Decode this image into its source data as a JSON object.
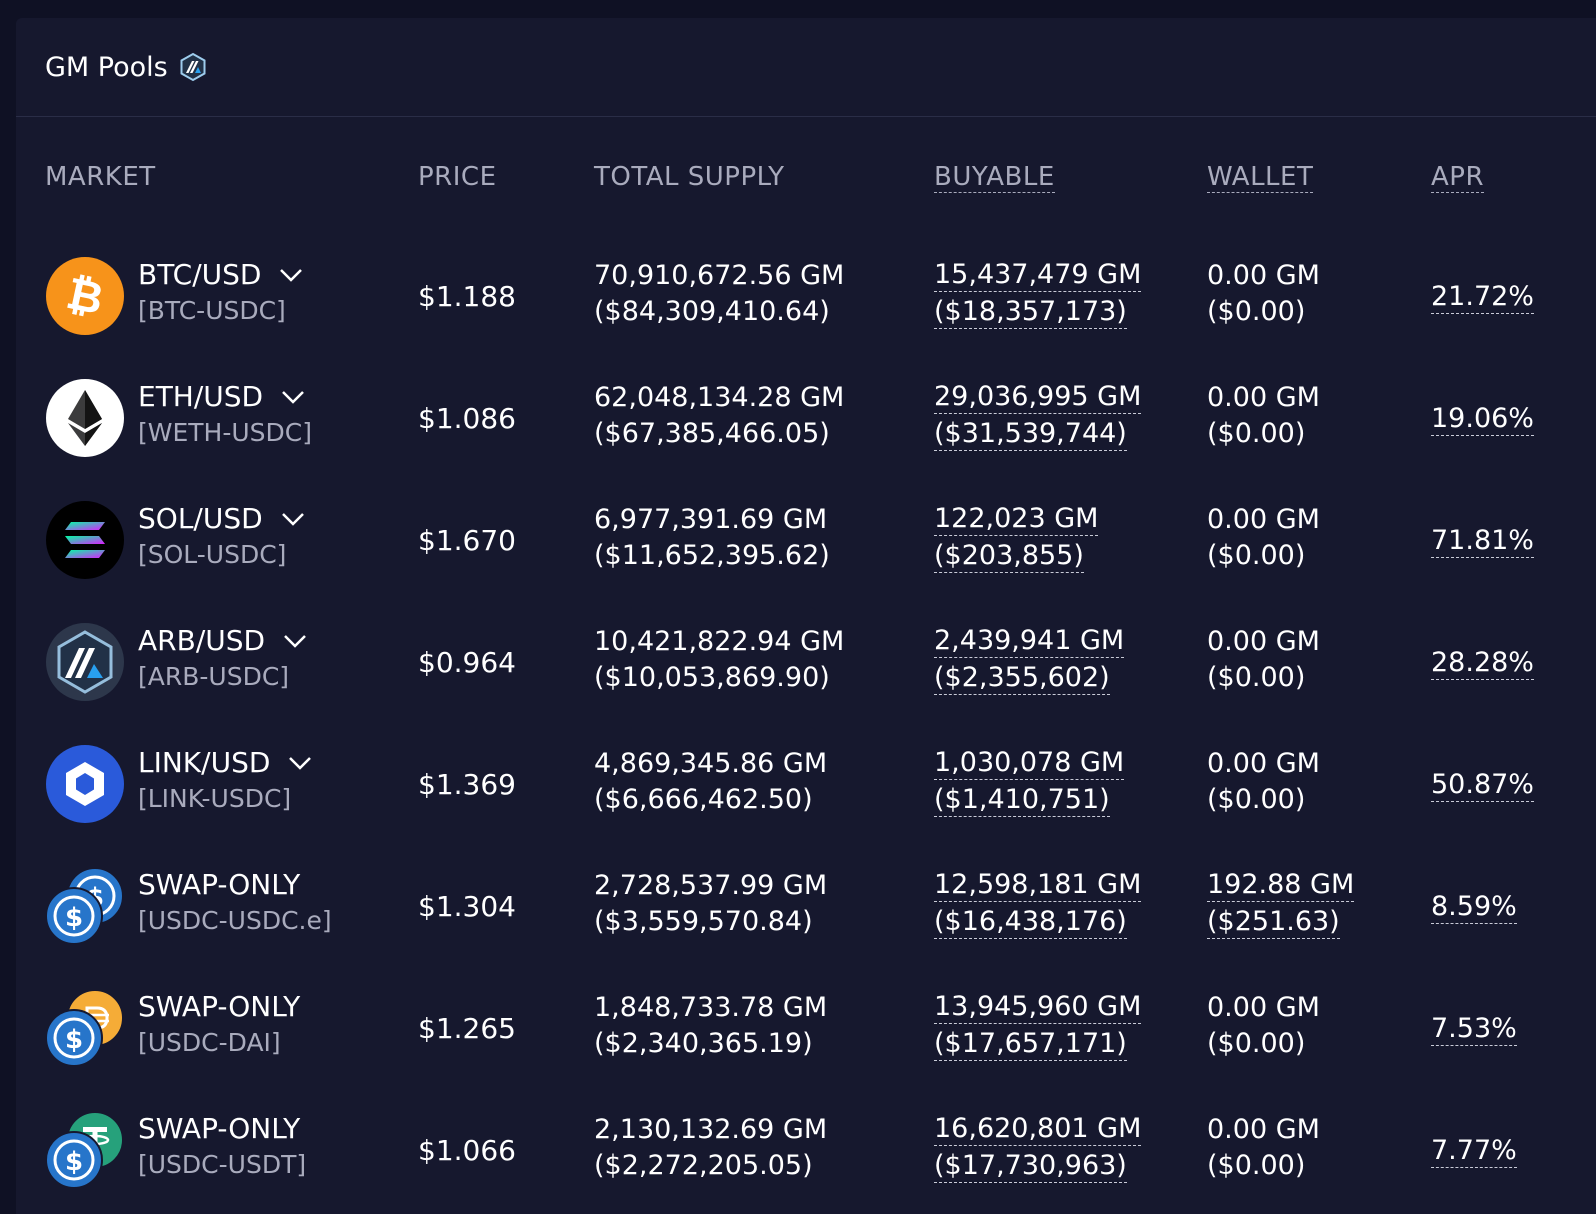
{
  "header": {
    "title": "GM Pools"
  },
  "columns": {
    "market": "MARKET",
    "price": "PRICE",
    "total_supply": "TOTAL SUPPLY",
    "buyable": "BUYABLE",
    "wallet": "WALLET",
    "apr": "APR"
  },
  "rows": [
    {
      "name": "BTC/USD",
      "pair": "[BTC-USDC]",
      "price": "$1.188",
      "supply_gm": "70,910,672.56 GM",
      "supply_usd": "($84,309,410.64)",
      "buyable_gm": "15,437,479 GM",
      "buyable_usd": "($18,357,173)",
      "wallet_gm": "0.00 GM",
      "wallet_usd": "($0.00)",
      "apr": "21.72%",
      "icon": "bitcoin-icon"
    },
    {
      "name": "ETH/USD",
      "pair": "[WETH-USDC]",
      "price": "$1.086",
      "supply_gm": "62,048,134.28 GM",
      "supply_usd": "($67,385,466.05)",
      "buyable_gm": "29,036,995 GM",
      "buyable_usd": "($31,539,744)",
      "wallet_gm": "0.00 GM",
      "wallet_usd": "($0.00)",
      "apr": "19.06%",
      "icon": "ethereum-icon"
    },
    {
      "name": "SOL/USD",
      "pair": "[SOL-USDC]",
      "price": "$1.670",
      "supply_gm": "6,977,391.69 GM",
      "supply_usd": "($11,652,395.62)",
      "buyable_gm": "122,023 GM",
      "buyable_usd": "($203,855)",
      "wallet_gm": "0.00 GM",
      "wallet_usd": "($0.00)",
      "apr": "71.81%",
      "icon": "solana-icon"
    },
    {
      "name": "ARB/USD",
      "pair": "[ARB-USDC]",
      "price": "$0.964",
      "supply_gm": "10,421,822.94 GM",
      "supply_usd": "($10,053,869.90)",
      "buyable_gm": "2,439,941 GM",
      "buyable_usd": "($2,355,602)",
      "wallet_gm": "0.00 GM",
      "wallet_usd": "($0.00)",
      "apr": "28.28%",
      "icon": "arbitrum-icon"
    },
    {
      "name": "LINK/USD",
      "pair": "[LINK-USDC]",
      "price": "$1.369",
      "supply_gm": "4,869,345.86 GM",
      "supply_usd": "($6,666,462.50)",
      "buyable_gm": "1,030,078 GM",
      "buyable_usd": "($1,410,751)",
      "wallet_gm": "0.00 GM",
      "wallet_usd": "($0.00)",
      "apr": "50.87%",
      "icon": "chainlink-icon"
    },
    {
      "name": "SWAP-ONLY",
      "pair": "[USDC-USDC.e]",
      "price": "$1.304",
      "supply_gm": "2,728,537.99 GM",
      "supply_usd": "($3,559,570.84)",
      "buyable_gm": "12,598,181 GM",
      "buyable_usd": "($16,438,176)",
      "wallet_gm": "192.88 GM",
      "wallet_usd": "($251.63)",
      "apr": "8.59%",
      "icon": "usdc-usdce-icon"
    },
    {
      "name": "SWAP-ONLY",
      "pair": "[USDC-DAI]",
      "price": "$1.265",
      "supply_gm": "1,848,733.78 GM",
      "supply_usd": "($2,340,365.19)",
      "buyable_gm": "13,945,960 GM",
      "buyable_usd": "($17,657,171)",
      "wallet_gm": "0.00 GM",
      "wallet_usd": "($0.00)",
      "apr": "7.53%",
      "icon": "usdc-dai-icon"
    },
    {
      "name": "SWAP-ONLY",
      "pair": "[USDC-USDT]",
      "price": "$1.066",
      "supply_gm": "2,130,132.69 GM",
      "supply_usd": "($2,272,205.05)",
      "buyable_gm": "16,620,801 GM",
      "buyable_usd": "($17,730,963)",
      "wallet_gm": "0.00 GM",
      "wallet_usd": "($0.00)",
      "apr": "7.77%",
      "icon": "usdc-usdt-icon"
    }
  ],
  "colors": {
    "background": "#0f1124",
    "panel": "#16182e",
    "muted_text": "#a9abbd",
    "bitcoin": "#f7931a",
    "usdc": "#2775ca",
    "chainlink": "#2a5ada",
    "dai": "#f5ac37",
    "usdt": "#26a17b"
  }
}
